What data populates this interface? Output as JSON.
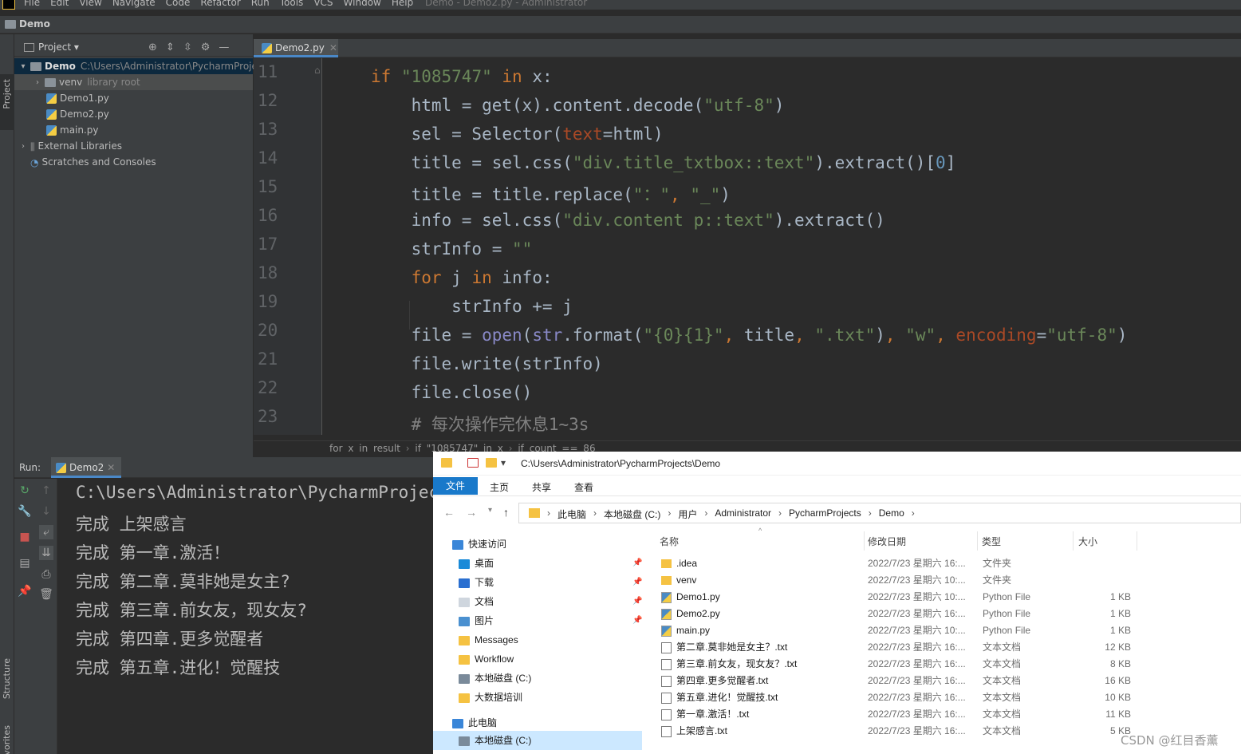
{
  "menubar": {
    "items": [
      "File",
      "Edit",
      "View",
      "Navigate",
      "Code",
      "Refactor",
      "Run",
      "Tools",
      "VCS",
      "Window",
      "Help"
    ],
    "window_title": "Demo - Demo2.py - Administrator"
  },
  "navbar": {
    "project_name": "Demo"
  },
  "side_labels": {
    "project": "Project",
    "structure": "Structure",
    "favorites": "Favorites"
  },
  "project_panel": {
    "title": "Project",
    "tree": [
      {
        "label": "Demo",
        "extra": "C:\\Users\\Administrator\\PycharmProjects\\Demo"
      },
      {
        "label": "venv",
        "extra": "library root"
      },
      {
        "label": "Demo1.py"
      },
      {
        "label": "Demo2.py"
      },
      {
        "label": "main.py"
      },
      {
        "label": "External Libraries"
      },
      {
        "label": "Scratches and Consoles"
      }
    ]
  },
  "editor": {
    "tab": "Demo2.py",
    "line_numbers": [
      "11",
      "12",
      "13",
      "14",
      "15",
      "16",
      "17",
      "18",
      "19",
      "20",
      "21",
      "22",
      "23"
    ],
    "lines": [
      [
        {
          "t": "kw",
          "v": "if "
        },
        {
          "t": "st",
          "v": "\"1085747\""
        },
        {
          "t": "kw",
          "v": " in "
        },
        {
          "t": "",
          "v": "x:"
        }
      ],
      [
        {
          "t": "",
          "v": "    html = get(x).content.decode("
        },
        {
          "t": "st",
          "v": "\"utf-8\""
        },
        {
          "t": "",
          "v": ")"
        }
      ],
      [
        {
          "t": "",
          "v": "    sel = Selector("
        },
        {
          "t": "pr",
          "v": "text"
        },
        {
          "t": "",
          "v": "=html)"
        }
      ],
      [
        {
          "t": "",
          "v": "    title = sel.css("
        },
        {
          "t": "st",
          "v": "\"div.title_txtbox::text\""
        },
        {
          "t": "",
          "v": ").extract()["
        },
        {
          "t": "nm",
          "v": "0"
        },
        {
          "t": "",
          "v": "]"
        }
      ],
      [
        {
          "t": "",
          "v": "    title = title.replace("
        },
        {
          "t": "st",
          "v": "\"：\""
        },
        {
          "t": "kw",
          "v": ", "
        },
        {
          "t": "st",
          "v": "\"_\""
        },
        {
          "t": "",
          "v": ")"
        }
      ],
      [
        {
          "t": "",
          "v": "    info = sel.css("
        },
        {
          "t": "st",
          "v": "\"div.content p::text\""
        },
        {
          "t": "",
          "v": ").extract()"
        }
      ],
      [
        {
          "t": "",
          "v": "    strInfo = "
        },
        {
          "t": "st",
          "v": "\"\""
        }
      ],
      [
        {
          "t": "kw",
          "v": "    for "
        },
        {
          "t": "",
          "v": "j "
        },
        {
          "t": "kw",
          "v": "in "
        },
        {
          "t": "",
          "v": "info:"
        }
      ],
      [
        {
          "t": "",
          "v": "        strInfo += j"
        }
      ],
      [
        {
          "t": "",
          "v": "    file = "
        },
        {
          "t": "bi",
          "v": "open"
        },
        {
          "t": "",
          "v": "("
        },
        {
          "t": "bi",
          "v": "str"
        },
        {
          "t": "",
          "v": ".format("
        },
        {
          "t": "st",
          "v": "\"{0}{1}\""
        },
        {
          "t": "kw",
          "v": ", "
        },
        {
          "t": "",
          "v": "title"
        },
        {
          "t": "kw",
          "v": ", "
        },
        {
          "t": "st",
          "v": "\".txt\""
        },
        {
          "t": "",
          "v": ")"
        },
        {
          "t": "kw",
          "v": ", "
        },
        {
          "t": "st",
          "v": "\"w\""
        },
        {
          "t": "kw",
          "v": ", "
        },
        {
          "t": "pr",
          "v": "encoding"
        },
        {
          "t": "",
          "v": "="
        },
        {
          "t": "st",
          "v": "\"utf-8\""
        },
        {
          "t": "",
          "v": ")"
        }
      ],
      [
        {
          "t": "",
          "v": "    file.write(strInfo)"
        }
      ],
      [
        {
          "t": "",
          "v": "    file.close()"
        }
      ],
      [
        {
          "t": "cm",
          "v": "    # 每次操作完休息1~3s"
        }
      ]
    ],
    "breadcrumb": [
      "for x in result",
      "if \"1085747\" in x",
      "if count == 86"
    ]
  },
  "run_panel": {
    "label": "Run:",
    "tab": "Demo2",
    "output": [
      "C:\\Users\\Administrator\\PycharmProjects\\Demo\\venv\\Scripts\\python.exe",
      "完成 上架感言",
      "完成 第一章.激活！",
      "完成 第二章.莫非她是女主?",
      "完成 第三章.前女友，现女友?",
      "完成 第四章.更多觉醒者",
      "完成 第五章.进化！觉醒技"
    ]
  },
  "explorer": {
    "title_path": "C:\\Users\\Administrator\\PycharmProjects\\Demo",
    "ribbon": {
      "file": "文件",
      "tabs": [
        "主页",
        "共享",
        "查看"
      ]
    },
    "address": [
      "此电脑",
      "本地磁盘 (C:)",
      "用户",
      "Administrator",
      "PycharmProjects",
      "Demo"
    ],
    "nav": [
      {
        "label": "快速访问",
        "icon": "#3a86d8",
        "pin": false
      },
      {
        "label": "桌面",
        "icon": "#1a8ad8",
        "pin": true
      },
      {
        "label": "下载",
        "icon": "#2a6fd0",
        "pin": true
      },
      {
        "label": "文档",
        "icon": "#cfd6de",
        "pin": true
      },
      {
        "label": "图片",
        "icon": "#4a90d0",
        "pin": true
      },
      {
        "label": "Messages",
        "icon": "#f5c242",
        "pin": false
      },
      {
        "label": "Workflow",
        "icon": "#f5c242",
        "pin": false
      },
      {
        "label": "本地磁盘 (C:)",
        "icon": "#7a8a9a",
        "pin": false
      },
      {
        "label": "大数据培训",
        "icon": "#f5c242",
        "pin": false
      },
      {
        "label": "此电脑",
        "icon": "#3a86d8",
        "pin": false
      },
      {
        "label": "本地磁盘 (C:)",
        "icon": "#7a8a9a",
        "pin": false
      }
    ],
    "columns": {
      "name": "名称",
      "date": "修改日期",
      "type": "类型",
      "size": "大小"
    },
    "files": [
      {
        "name": ".idea",
        "date": "2022/7/23 星期六 16:...",
        "type": "文件夹",
        "size": "",
        "kind": "folder"
      },
      {
        "name": "venv",
        "date": "2022/7/23 星期六 10:...",
        "type": "文件夹",
        "size": "",
        "kind": "folder"
      },
      {
        "name": "Demo1.py",
        "date": "2022/7/23 星期六 10:...",
        "type": "Python File",
        "size": "1 KB",
        "kind": "py"
      },
      {
        "name": "Demo2.py",
        "date": "2022/7/23 星期六 16:...",
        "type": "Python File",
        "size": "1 KB",
        "kind": "py"
      },
      {
        "name": "main.py",
        "date": "2022/7/23 星期六 10:...",
        "type": "Python File",
        "size": "1 KB",
        "kind": "py"
      },
      {
        "name": "第二章.莫非她是女主？.txt",
        "date": "2022/7/23 星期六 16:...",
        "type": "文本文档",
        "size": "12 KB",
        "kind": "txt"
      },
      {
        "name": "第三章.前女友，现女友？.txt",
        "date": "2022/7/23 星期六 16:...",
        "type": "文本文档",
        "size": "8 KB",
        "kind": "txt"
      },
      {
        "name": "第四章.更多觉醒者.txt",
        "date": "2022/7/23 星期六 16:...",
        "type": "文本文档",
        "size": "16 KB",
        "kind": "txt"
      },
      {
        "name": "第五章.进化！觉醒技.txt",
        "date": "2022/7/23 星期六 16:...",
        "type": "文本文档",
        "size": "10 KB",
        "kind": "txt"
      },
      {
        "name": "第一章.激活！.txt",
        "date": "2022/7/23 星期六 16:...",
        "type": "文本文档",
        "size": "11 KB",
        "kind": "txt"
      },
      {
        "name": "上架感言.txt",
        "date": "2022/7/23 星期六 16:...",
        "type": "文本文档",
        "size": "5 KB",
        "kind": "txt"
      }
    ]
  },
  "watermark": "CSDN @红目香薰"
}
